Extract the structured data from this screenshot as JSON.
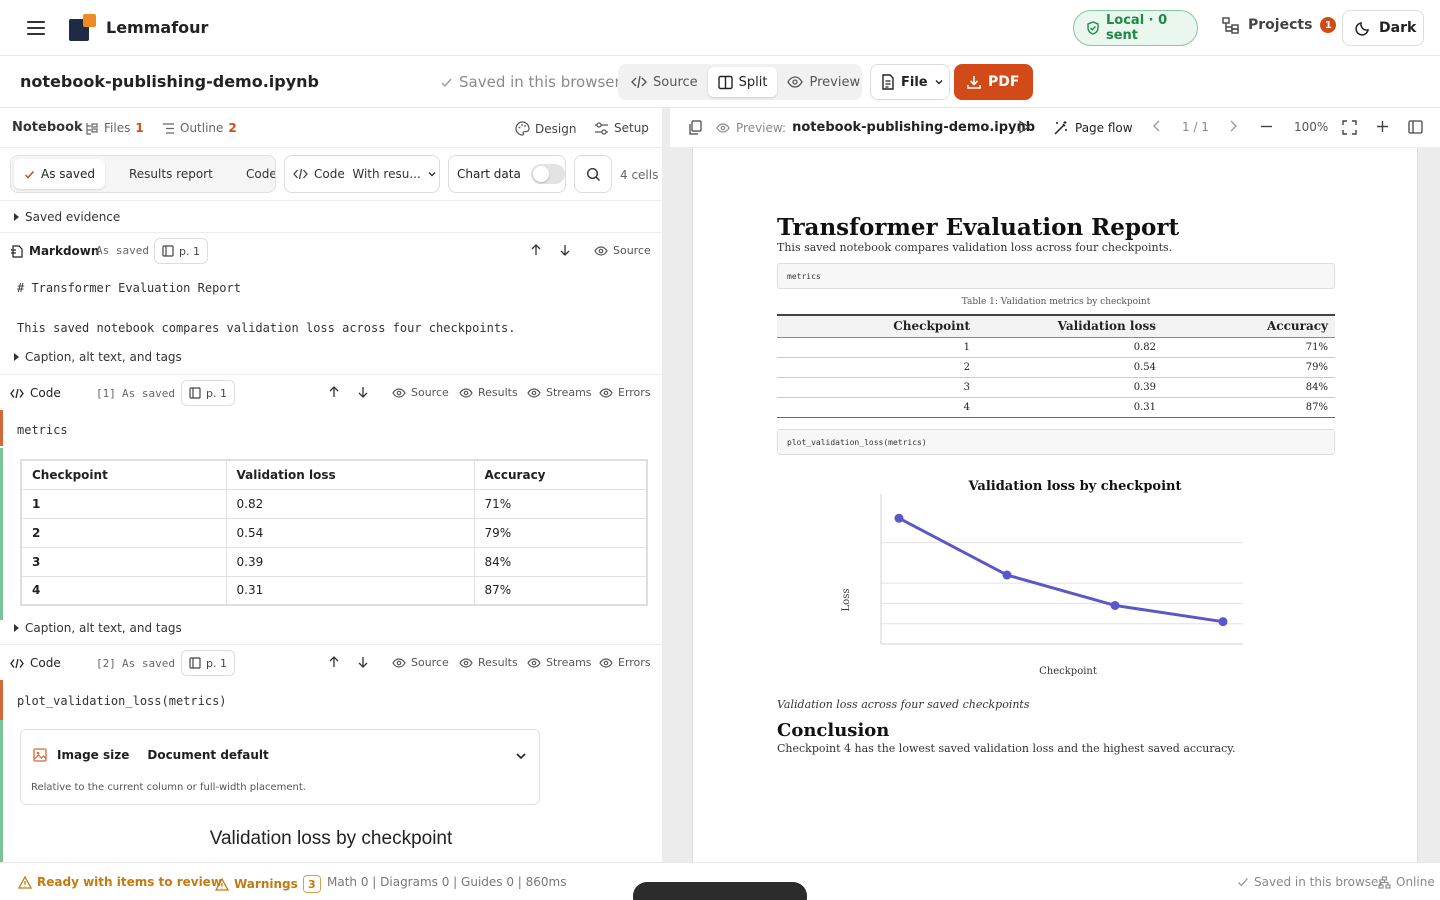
{
  "app": {
    "brand": "Lemmafour",
    "local_status": "Local · 0 sent",
    "projects_label": "Projects",
    "projects_count": "1",
    "theme_label": "Dark"
  },
  "document": {
    "filename": "notebook-publishing-demo.ipynb",
    "saved_note": "Saved in this browser",
    "views": [
      "Source",
      "Split",
      "Preview"
    ],
    "active_view": "Split",
    "file_label": "File",
    "export_label": "PDF"
  },
  "notebook_tabs": {
    "notebook": "Notebook",
    "files": "Files",
    "files_count": "1",
    "outline": "Outline",
    "outline_count": "2",
    "design": "Design",
    "setup": "Setup"
  },
  "toolbar": {
    "modes": [
      "As saved",
      "Results report",
      "Code +"
    ],
    "active_mode": "As saved",
    "code_select": "Code  With resu...",
    "chart_data_label": "Chart data",
    "cells_count": "4 cells"
  },
  "cells": {
    "saved_evidence": "Saved evidence",
    "caption_toggle": "Caption, alt text, and tags",
    "markdown": {
      "kind": "Markdown",
      "state": "As saved",
      "page": "p. 1",
      "source_action": "Source",
      "line1": "# Transformer Evaluation Report",
      "line2": "This saved notebook compares validation loss across four checkpoints."
    },
    "code1": {
      "kind": "Code",
      "exec": "[1]",
      "state": "As saved",
      "page": "p. 1",
      "actions": [
        "Source",
        "Results",
        "Streams",
        "Errors"
      ],
      "source": "metrics",
      "table_headers": [
        "Checkpoint",
        "Validation loss",
        "Accuracy"
      ],
      "table_rows": [
        [
          "1",
          "0.82",
          "71%"
        ],
        [
          "2",
          "0.54",
          "79%"
        ],
        [
          "3",
          "0.39",
          "84%"
        ],
        [
          "4",
          "0.31",
          "87%"
        ]
      ]
    },
    "code2": {
      "kind": "Code",
      "exec": "[2]",
      "state": "As saved",
      "page": "p. 1",
      "actions": [
        "Source",
        "Results",
        "Streams",
        "Errors"
      ],
      "source": "plot_validation_loss(metrics)",
      "image_size_label": "Image size",
      "image_size_value": "Document default",
      "image_size_hint": "Relative to the current column or full-width placement.",
      "output_title": "Validation loss by checkpoint"
    }
  },
  "preview": {
    "label": "Preview:",
    "filename": "notebook-publishing-demo.ipynb",
    "page_flow": "Page flow",
    "page_indicator": "1 / 1",
    "zoom": "100%",
    "report": {
      "title": "Transformer Evaluation Report",
      "subtitle": "This saved notebook compares validation loss across four checkpoints.",
      "code1": "metrics",
      "table_caption": "Table 1: Validation metrics by checkpoint",
      "table_headers": [
        "Checkpoint",
        "Validation loss",
        "Accuracy"
      ],
      "table_rows": [
        [
          "1",
          "0.82",
          "71%"
        ],
        [
          "2",
          "0.54",
          "79%"
        ],
        [
          "3",
          "0.39",
          "84%"
        ],
        [
          "4",
          "0.31",
          "87%"
        ]
      ],
      "code2": "plot_validation_loss(metrics)",
      "figure_caption": "Validation loss across four saved checkpoints",
      "conclusion_title": "Conclusion",
      "conclusion_text": "Checkpoint 4 has the lowest saved validation loss and the highest saved accuracy."
    }
  },
  "chart_data": {
    "type": "line",
    "title": "Validation loss by checkpoint",
    "xlabel": "Checkpoint",
    "ylabel": "Loss",
    "x": [
      1,
      2,
      3,
      4
    ],
    "values": [
      0.82,
      0.54,
      0.39,
      0.31
    ],
    "ylim": [
      0.2,
      0.9
    ],
    "grid": true,
    "color": "#5b57c9"
  },
  "status": {
    "ready": "Ready with items to review",
    "warnings_label": "Warnings",
    "warnings_count": "3",
    "stats": "Math 0 | Diagrams 0 | Guides 0 | 860ms",
    "saved": "Saved in this browser",
    "online": "Online"
  },
  "colors": {
    "accent": "#d24a18",
    "success": "#1d8a45",
    "markdown_gutter": "#7bc49a",
    "code_gutter": "#d2693a",
    "warning": "#c47a0e"
  }
}
